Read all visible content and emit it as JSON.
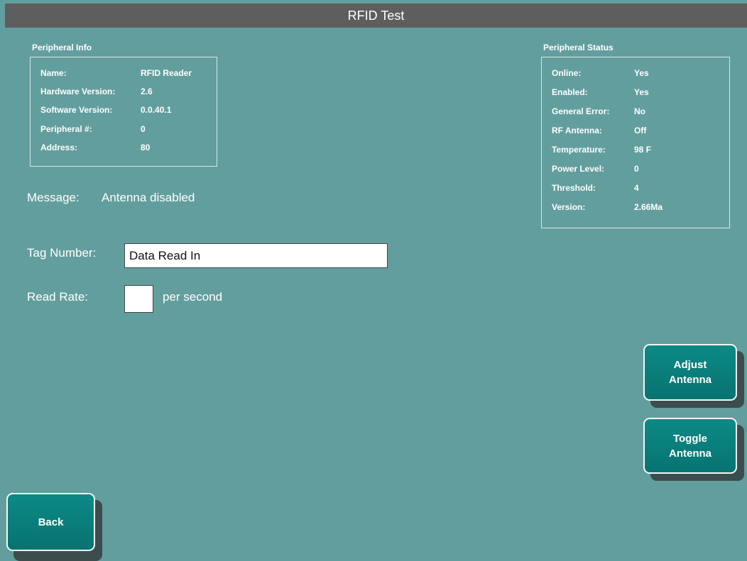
{
  "window": {
    "title": "RFID Test"
  },
  "peripheral_info": {
    "heading": "Peripheral Info",
    "rows": [
      {
        "label": "Name:",
        "value": "RFID Reader"
      },
      {
        "label": "Hardware Version:",
        "value": "2.6"
      },
      {
        "label": "Software Version:",
        "value": "0.0.40.1"
      },
      {
        "label": "Peripheral #:",
        "value": "0"
      },
      {
        "label": "Address:",
        "value": "80"
      }
    ]
  },
  "peripheral_status": {
    "heading": "Peripheral Status",
    "rows": [
      {
        "label": "Online:",
        "value": "Yes"
      },
      {
        "label": "Enabled:",
        "value": "Yes"
      },
      {
        "label": "General Error:",
        "value": "No"
      },
      {
        "label": "RF Antenna:",
        "value": "Off"
      },
      {
        "label": "Temperature:",
        "value": "98 F"
      },
      {
        "label": "Power Level:",
        "value": "0"
      },
      {
        "label": "Threshold:",
        "value": "4"
      },
      {
        "label": "Version:",
        "value": "2.66Ma"
      }
    ]
  },
  "message": {
    "label": "Message:",
    "value": "Antenna disabled"
  },
  "tag_number": {
    "label": "Tag Number:",
    "value": "Data Read In"
  },
  "read_rate": {
    "label": "Read Rate:",
    "value": "",
    "unit": "per second"
  },
  "buttons": {
    "adjust_antenna": "Adjust\nAntenna",
    "toggle_antenna": "Toggle\nAntenna",
    "back": "Back"
  },
  "colors": {
    "background": "#639e9e",
    "titlebar": "#5e5e5e",
    "button": "#087370",
    "button_shadow": "#3b4d4d"
  }
}
